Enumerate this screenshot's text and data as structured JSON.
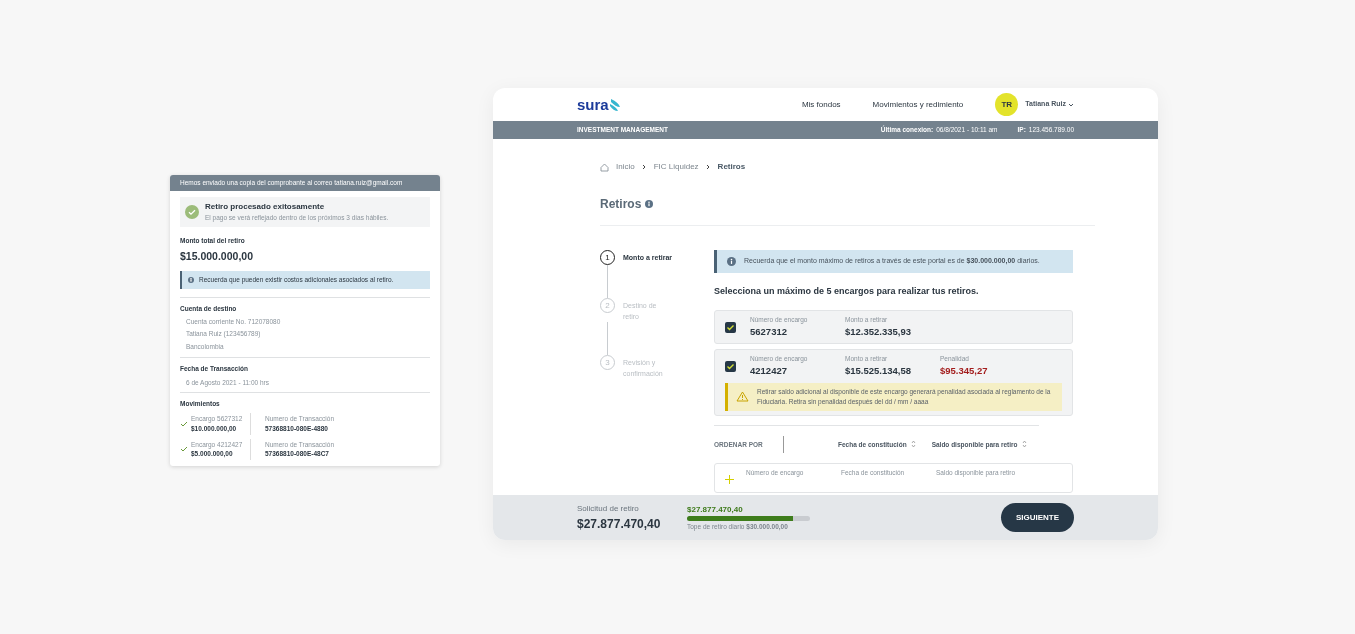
{
  "receipt": {
    "banner": "Hemos enviado una copia del comprobante al correo tatiana.ruiz@gmail.com",
    "success": {
      "title": "Retiro procesado exitosamente",
      "message": "El pago se verá reflejado dentro de los próximos 3 días hábiles."
    },
    "total_label": "Monto total del retiro",
    "total_amount": "$15.000.000,00",
    "info": "Recuerda que pueden existir costos adicionales asociados al retiro.",
    "destination": {
      "heading": "Cuenta de destino",
      "lines": [
        "Cuenta corriente No. 712078080",
        "Tatiana Ruiz (123456789)",
        "Bancolombia"
      ]
    },
    "date": {
      "heading": "Fecha de Transacción",
      "value": "6 de Agosto 2021 - 11:00 hrs"
    },
    "movements": {
      "heading": "Movimientos",
      "items": [
        {
          "encargo": "Encargo 5627312",
          "amount": "$10.000.000,00",
          "transaction_label": "Numero de Transacción",
          "transaction": "57368810-080E-4880"
        },
        {
          "encargo": "Encargo 4212427",
          "amount": "$5.000.000,00",
          "transaction_label": "Numero de Transacción",
          "transaction": "57368810-080E-48C7"
        }
      ]
    }
  },
  "app": {
    "logo": "sura",
    "nav": [
      "Mis fondos",
      "Movimientos y redimiento"
    ],
    "user": {
      "initials": "TR",
      "name": "Tatiana Ruiz"
    },
    "subbar": {
      "title": "INVESTMENT MANAGEMENT",
      "last_connection_label": "Última conexion:",
      "last_connection": "06/8/2021 - 10:11 am",
      "ip_label": "IP:",
      "ip": "123.456.789.00"
    },
    "breadcrumb": [
      {
        "label": "Inicio",
        "current": false
      },
      {
        "label": "FIC Liquidez",
        "current": false
      },
      {
        "label": "Retiros",
        "current": true
      }
    ],
    "page_title": "Retiros",
    "steps": [
      {
        "number": "1",
        "label": "Monto a retirar",
        "active": true
      },
      {
        "number": "2",
        "label": "Destino de retiro",
        "active": false
      },
      {
        "number": "3",
        "label": "Revisión y confirmación",
        "active": false
      }
    ],
    "alert": "Recuerda que el monto máximo de retiros a través de este portal es de **$30.000.000,00** diarios.",
    "instruction": "Selecciona un máximo de 5 encargos para realizar tus retiros.",
    "encargos": [
      {
        "checked": true,
        "fields": [
          {
            "kind": "plain",
            "label": "Número de encargo",
            "value": "5627312"
          },
          {
            "kind": "plain",
            "label": "Monto a retirar",
            "value": "$12.352.335,93"
          }
        ]
      },
      {
        "checked": true,
        "fields": [
          {
            "kind": "plain",
            "label": "Número de encargo",
            "value": "4212427"
          },
          {
            "kind": "plain",
            "label": "Monto a retirar",
            "value": "$15.525.134,58"
          },
          {
            "kind": "penalty",
            "label": "Penalidad",
            "value": "$95.345,27"
          }
        ],
        "warning": "Retirar saldo adicional al disponible de este encargo generará penalidad asociada al reglamento de la Fiduciaria. Retira sin penalidad después del dd / mm / aaaa"
      }
    ],
    "sort": {
      "label": "ORDENAR POR",
      "options": [
        "Fecha de constitución",
        "Saldo disponible para retiro"
      ]
    },
    "pending_row": {
      "labels": [
        "Número de encargo",
        "Fecha de constitución",
        "Saldo disponible para retiro"
      ]
    },
    "footer": {
      "request_label": "Solicitud de retiro",
      "request_amount": "$27.877.470,40",
      "progress_amount": "$27.877.470,40",
      "level": 0.86,
      "limit": "Tope de retiro diario **$30.000.00,00**",
      "button": "SIGUIENTE"
    }
  }
}
